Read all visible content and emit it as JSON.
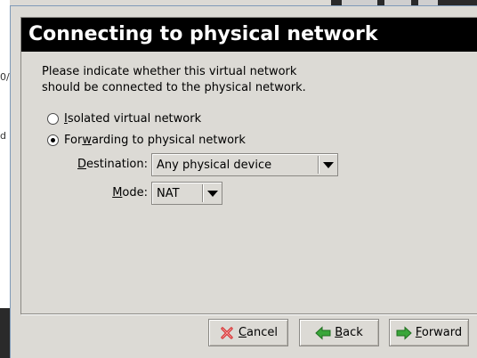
{
  "background": {
    "left_fragments": [
      "0/",
      "d"
    ]
  },
  "dialog": {
    "title": "Connecting to physical network",
    "intro_line1": "Please indicate whether this virtual network",
    "intro_line2": "should be connected to the physical network.",
    "options": {
      "isolated": {
        "mnemonic": "I",
        "rest": "solated virtual network",
        "selected": false
      },
      "forwarding": {
        "prefix": "For",
        "mnemonic": "w",
        "rest": "arding to physical network",
        "selected": true
      }
    },
    "destination": {
      "label_mnemonic": "D",
      "label_rest": "estination:",
      "value": "Any physical device"
    },
    "mode": {
      "label_mnemonic": "M",
      "label_rest": "ode:",
      "value": "NAT"
    },
    "buttons": {
      "cancel": {
        "mnemonic": "C",
        "rest": "ancel",
        "icon": "cancel-x-icon"
      },
      "back": {
        "mnemonic": "B",
        "rest": "ack",
        "icon": "back-arrow-icon"
      },
      "forward": {
        "mnemonic": "F",
        "rest": "orward",
        "icon": "forward-arrow-icon"
      }
    }
  },
  "colors": {
    "header_bg": "#000000",
    "header_fg": "#ffffff",
    "window_bg": "#dcdad5",
    "cancel_icon": "#d62c2c",
    "arrow_icon": "#3aa63a"
  }
}
